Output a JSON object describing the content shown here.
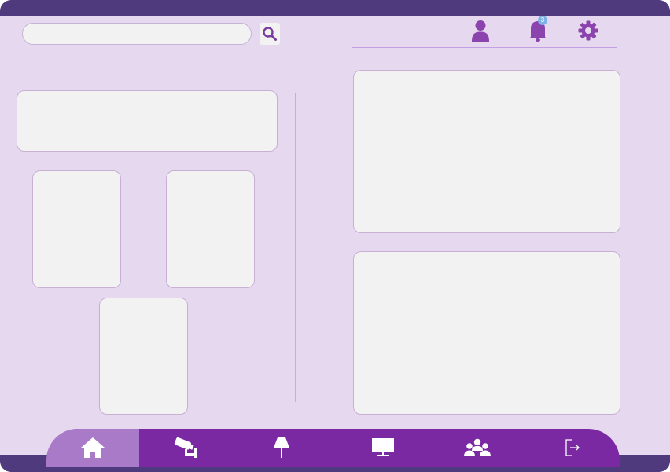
{
  "search": {
    "value": "",
    "placeholder": "",
    "button_icon": "search-icon"
  },
  "header": {
    "icons": [
      "user-icon",
      "bell-icon",
      "gear-icon"
    ],
    "notification_count": "3"
  },
  "nav": {
    "active": "home",
    "items": [
      {
        "id": "home",
        "icon": "home-icon"
      },
      {
        "id": "cameras",
        "icon": "security-camera-icon"
      },
      {
        "id": "lamp",
        "icon": "lamp-icon"
      },
      {
        "id": "display",
        "icon": "monitor-icon"
      },
      {
        "id": "users",
        "icon": "group-icon"
      },
      {
        "id": "logout",
        "icon": "logout-icon"
      }
    ]
  },
  "colors": {
    "background": "#e6d8ef",
    "top_bar": "#4f3a7e",
    "nav_bar": "#7b28a3",
    "nav_active": "#a97ac8",
    "icon_purple": "#7b3a9e",
    "badge": "#7fb3e6",
    "card": "#f2f2f2"
  }
}
